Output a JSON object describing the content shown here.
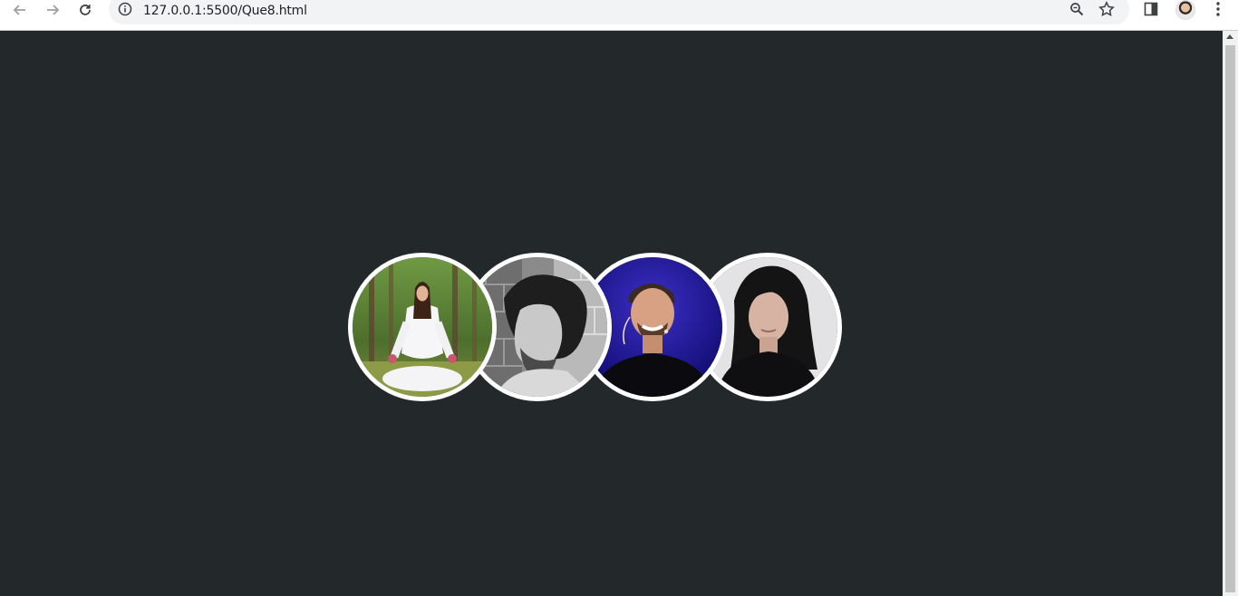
{
  "browser": {
    "url": "127.0.0.1:5500/Que8.html",
    "icons": [
      "back-arrow-icon",
      "forward-arrow-icon",
      "reload-icon",
      "site-info-icon",
      "zoom-icon",
      "bookmark-star-icon",
      "side-panel-icon",
      "profile-avatar",
      "menu-kebab-icon"
    ]
  },
  "page": {
    "background": "#23282b",
    "avatars": [
      {
        "subject": "woman meditating in forest"
      },
      {
        "subject": "man with curly hair, black and white"
      },
      {
        "subject": "smiling man with headset mic, blue background"
      },
      {
        "subject": "woman with dark hair, black top"
      }
    ],
    "border_color": "#ffffff"
  }
}
